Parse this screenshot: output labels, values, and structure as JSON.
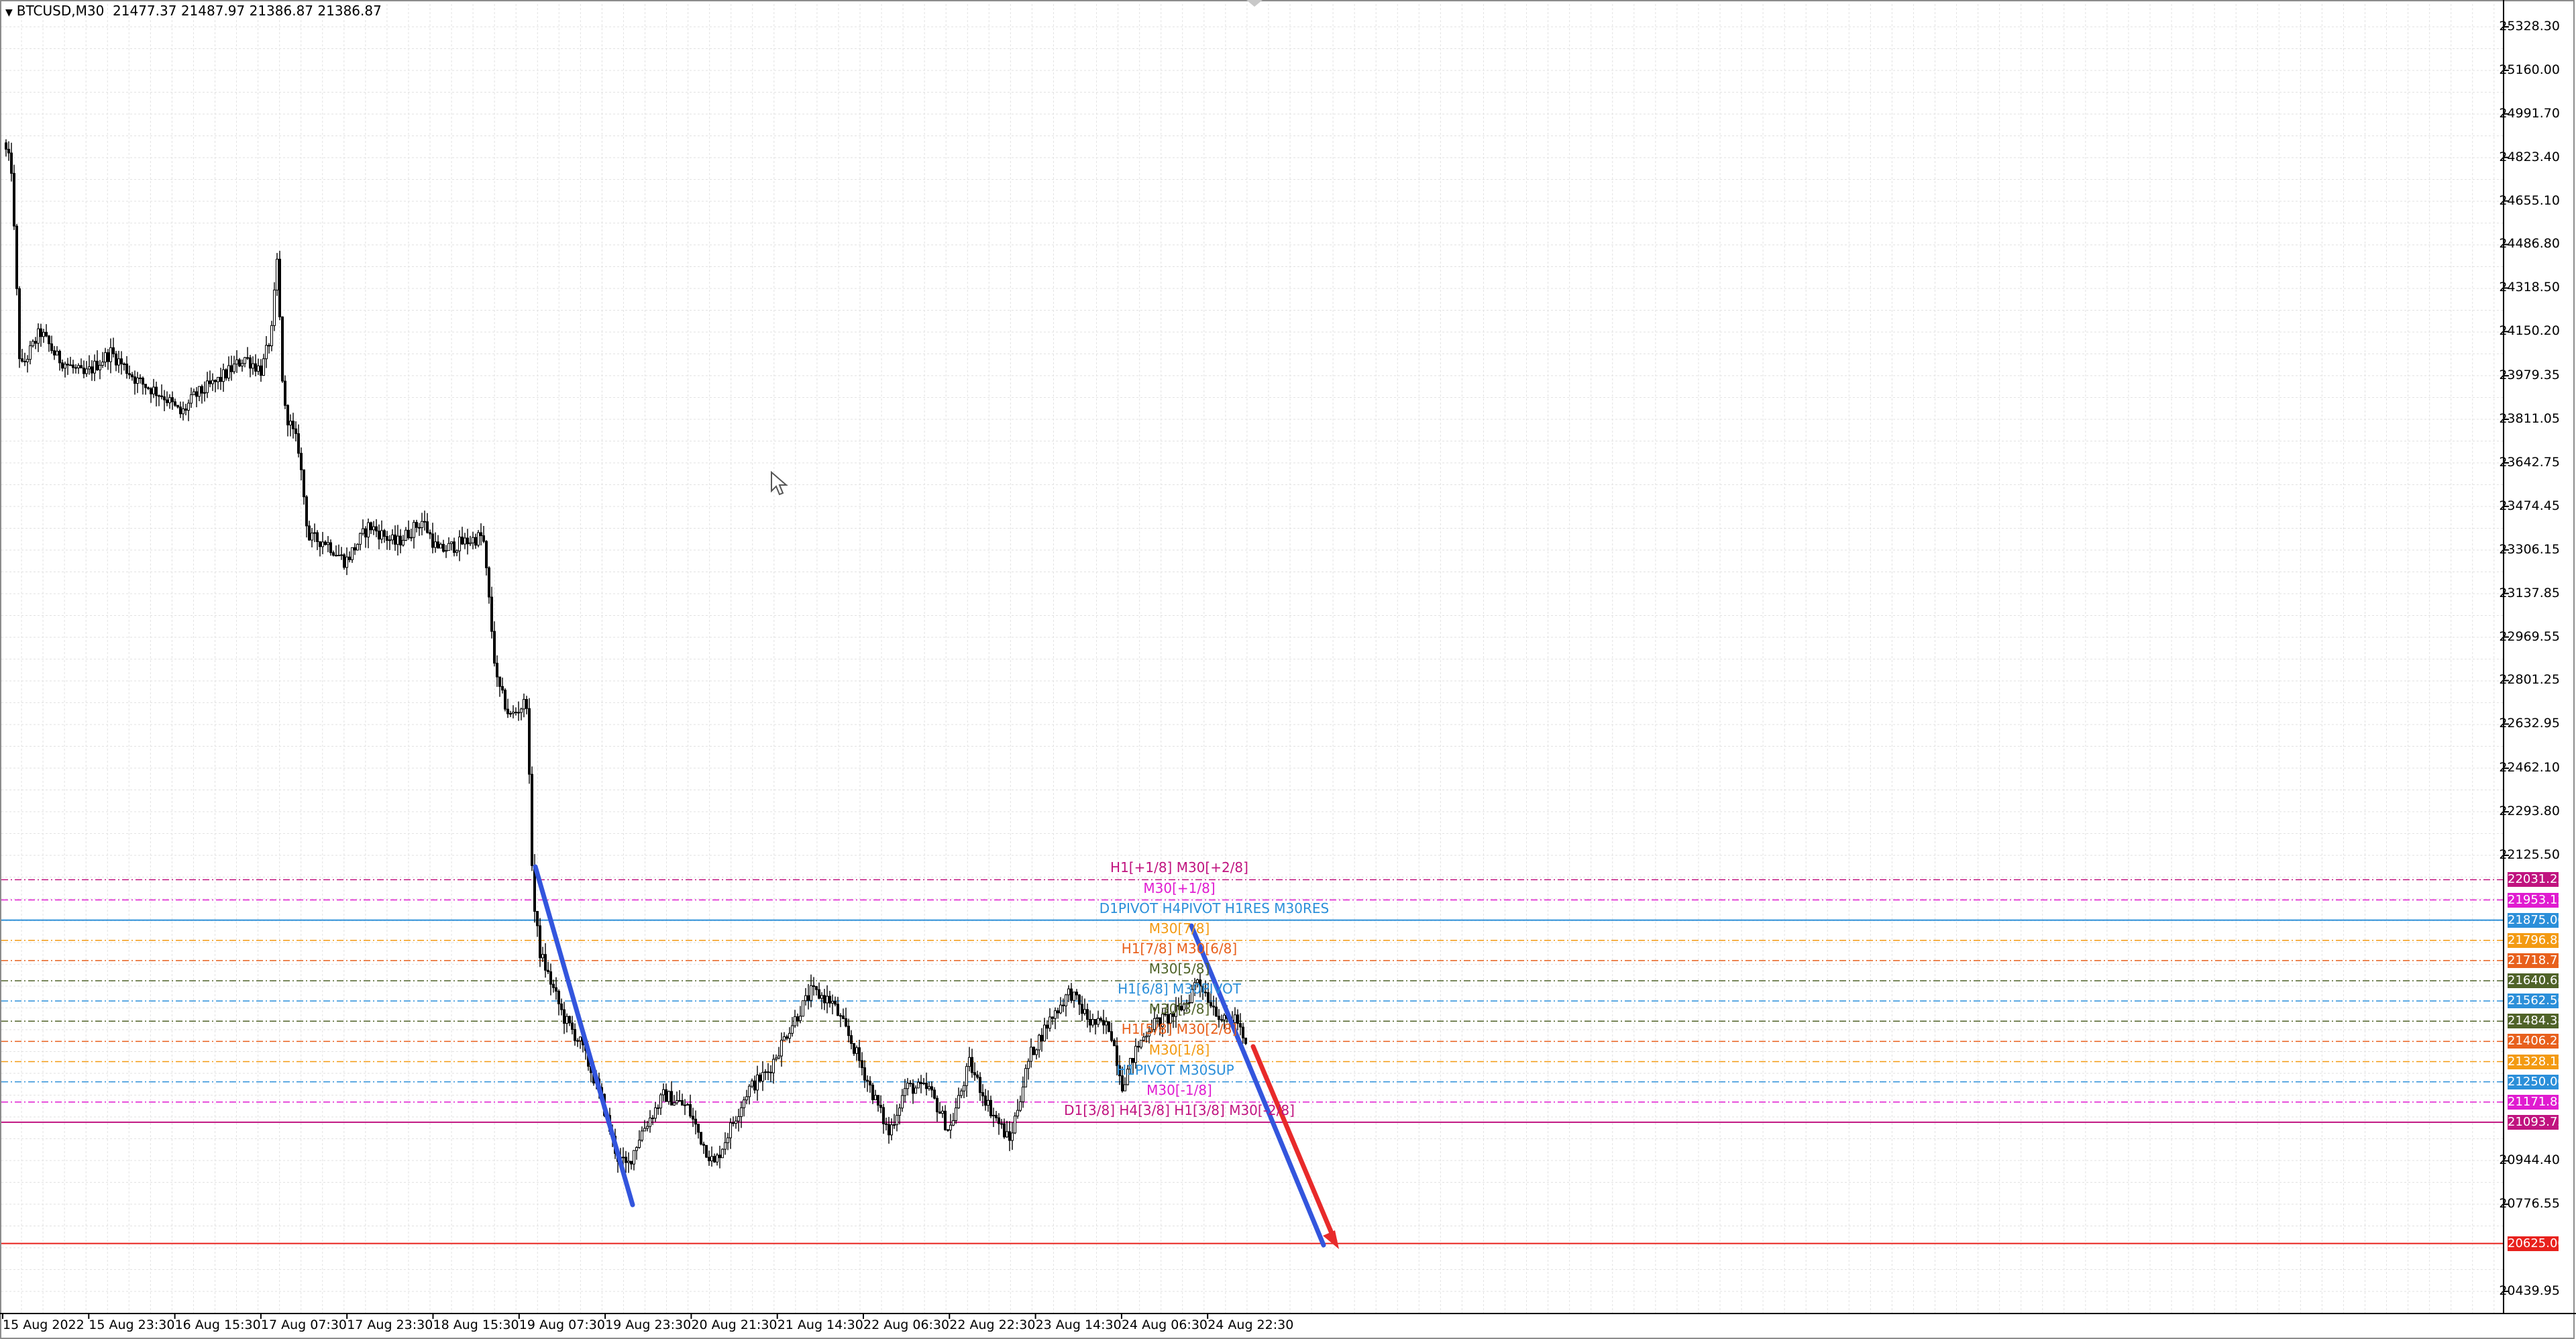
{
  "header": {
    "symbol": "BTCUSD,M30",
    "ohlc": "21477.37 21487.97 21386.87 21386.87"
  },
  "price_axis": [
    {
      "price": 25328.3,
      "label": "25328.30"
    },
    {
      "price": 25160.0,
      "label": "25160.00"
    },
    {
      "price": 24991.7,
      "label": "24991.70"
    },
    {
      "price": 24823.4,
      "label": "24823.40"
    },
    {
      "price": 24655.1,
      "label": "24655.10"
    },
    {
      "price": 24486.8,
      "label": "24486.80"
    },
    {
      "price": 24318.5,
      "label": "24318.50"
    },
    {
      "price": 24150.2,
      "label": "24150.20"
    },
    {
      "price": 23979.35,
      "label": "23979.35"
    },
    {
      "price": 23811.05,
      "label": "23811.05"
    },
    {
      "price": 23642.75,
      "label": "23642.75"
    },
    {
      "price": 23474.45,
      "label": "23474.45"
    },
    {
      "price": 23306.15,
      "label": "23306.15"
    },
    {
      "price": 23137.85,
      "label": "23137.85"
    },
    {
      "price": 22969.55,
      "label": "22969.55"
    },
    {
      "price": 22801.25,
      "label": "22801.25"
    },
    {
      "price": 22632.95,
      "label": "22632.95"
    },
    {
      "price": 22462.1,
      "label": "22462.10"
    },
    {
      "price": 22293.8,
      "label": "22293.80"
    },
    {
      "price": 22125.5,
      "label": "22125.50"
    },
    {
      "price": 20944.4,
      "label": "20944.40"
    },
    {
      "price": 20776.55,
      "label": "20776.55"
    },
    {
      "price": 20439.95,
      "label": "20439.95"
    }
  ],
  "time_axis": [
    "15 Aug 2022",
    "15 Aug 23:30",
    "16 Aug 15:30",
    "17 Aug 07:30",
    "17 Aug 23:30",
    "18 Aug 15:30",
    "19 Aug 07:30",
    "19 Aug 23:30",
    "20 Aug 21:30",
    "21 Aug 14:30",
    "22 Aug 06:30",
    "22 Aug 22:30",
    "23 Aug 14:30",
    "24 Aug 06:30",
    "24 Aug 22:30"
  ],
  "levels": [
    {
      "price": 22031.25,
      "label": "22031.25",
      "color": "#c0137f",
      "text": "H1[+1/8] M30[+2/8]"
    },
    {
      "price": 21953.12,
      "label": "21953.12",
      "color": "#e01bd0",
      "text": "M30[+1/8]"
    },
    {
      "price": 21875.0,
      "label": "21875.00",
      "color": "#2b8fd9",
      "text": "D1PIVOT H4PIVOT H1RES M30RES"
    },
    {
      "price": 21796.88,
      "label": "21796.88",
      "color": "#f39a12",
      "text": "M30[7/8]"
    },
    {
      "price": 21718.75,
      "label": "21718.75",
      "color": "#e8601c",
      "text": "H1[7/8] M30[6/8]"
    },
    {
      "price": 21640.62,
      "label": "21640.62",
      "color": "#4f6228",
      "text": "M30[5/8]"
    },
    {
      "price": 21562.5,
      "label": "21562.50",
      "color": "#2b8fd9",
      "text": "H1[6/8] M30PIVOT"
    },
    {
      "price": 21484.38,
      "label": "21484.38",
      "color": "#4f6228",
      "text": "M30[3/8]"
    },
    {
      "price": 21406.25,
      "label": "21406.25",
      "color": "#e8601c",
      "text": "H1[5/8] M30[2/8]"
    },
    {
      "price": 21328.12,
      "label": "21328.12",
      "color": "#f39a12",
      "text": "M30[1/8]"
    },
    {
      "price": 21250.0,
      "label": "21250.00",
      "color": "#2b8fd9",
      "text": "H1PIVOT M30SUP"
    },
    {
      "price": 21171.88,
      "label": "21171.88",
      "color": "#e01bd0",
      "text": "M30[-1/8]"
    },
    {
      "price": 21093.75,
      "label": "21093.75",
      "color": "#c0137f",
      "text": "D1[3/8] H4[3/8] H1[3/8] M30[-2/8]"
    },
    {
      "price": 20625.0,
      "label": "20625.00",
      "color": "#e8211c",
      "text": ""
    }
  ],
  "colors": {
    "grid": "#e2e2e2",
    "candle": "#000000",
    "trend_blue": "#3355dd",
    "trend_red": "#e82a2a",
    "target_line": "#e8211c"
  }
}
